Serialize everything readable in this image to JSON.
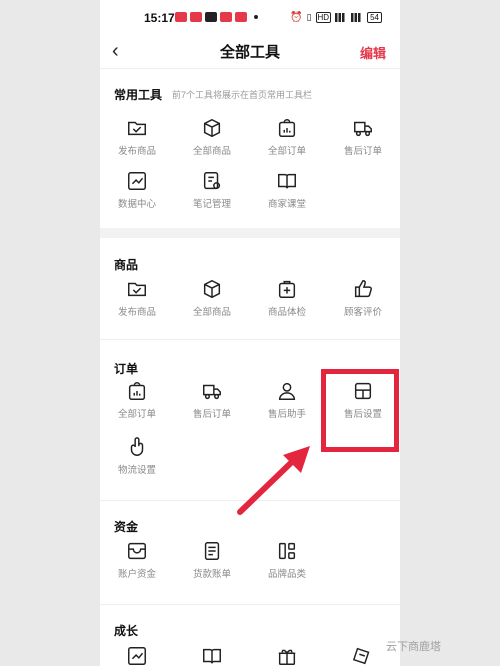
{
  "status": {
    "time": "15:17",
    "battery": "54",
    "hd": "HD"
  },
  "nav": {
    "title": "全部工具",
    "edit": "编辑",
    "back": "‹"
  },
  "common": {
    "title": "常用工具",
    "hint": "前7个工具将展示在首页常用工具栏",
    "items": [
      {
        "label": "发布商品",
        "icon": "folder-check-icon"
      },
      {
        "label": "全部商品",
        "icon": "box-icon"
      },
      {
        "label": "全部订单",
        "icon": "chart-bag-icon"
      },
      {
        "label": "售后订单",
        "icon": "truck-icon"
      },
      {
        "label": "数据中心",
        "icon": "trend-icon"
      },
      {
        "label": "笔记管理",
        "icon": "note-gear-icon"
      },
      {
        "label": "商家课堂",
        "icon": "book-icon"
      }
    ]
  },
  "goods": {
    "title": "商品",
    "items": [
      {
        "label": "发布商品",
        "icon": "folder-check-icon"
      },
      {
        "label": "全部商品",
        "icon": "box-icon"
      },
      {
        "label": "商品体检",
        "icon": "medical-bag-icon"
      },
      {
        "label": "顾客评价",
        "icon": "thumbs-up-icon"
      }
    ]
  },
  "orders": {
    "title": "订单",
    "items": [
      {
        "label": "全部订单",
        "icon": "chart-bag-icon"
      },
      {
        "label": "售后订单",
        "icon": "truck-icon"
      },
      {
        "label": "售后助手",
        "icon": "person-icon"
      },
      {
        "label": "售后设置",
        "icon": "layout-icon"
      },
      {
        "label": "物流设置",
        "icon": "hand-icon"
      }
    ]
  },
  "funds": {
    "title": "资金",
    "items": [
      {
        "label": "账户资金",
        "icon": "wallet-icon"
      },
      {
        "label": "货款账单",
        "icon": "bill-icon"
      },
      {
        "label": "品牌品类",
        "icon": "grid-icon"
      }
    ]
  },
  "growth": {
    "title": "成长"
  },
  "watermark": "云下商鹿塔",
  "colors": {
    "accent": "#e5394b",
    "highlight": "#e3253e"
  }
}
